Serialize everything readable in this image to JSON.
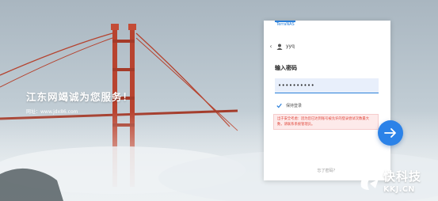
{
  "promo": {
    "title": "江东网竭诚为您服务！",
    "site": "网址：www.jdx86.com"
  },
  "login": {
    "tab_label": "TerraNAS",
    "back_icon": "back-arrow-icon",
    "user_icon": "user-icon",
    "username": "yyq",
    "heading": "输入密码",
    "password_value": "••••••••••",
    "remember_label": "保持登录",
    "remember_checked": true,
    "error_message": "出于安全考虑：因为您已达到账号被允许的登录尝试次数最大数，请联系系统管理员。",
    "forgot_label": "忘了密码？",
    "submit_icon": "arrow-right-icon"
  },
  "watermark": {
    "main": "快科技",
    "sub": "KKJ.CN"
  },
  "colors": {
    "accent": "#2b82e8",
    "error_text": "#e0473b",
    "error_bg": "#fdeaea"
  }
}
